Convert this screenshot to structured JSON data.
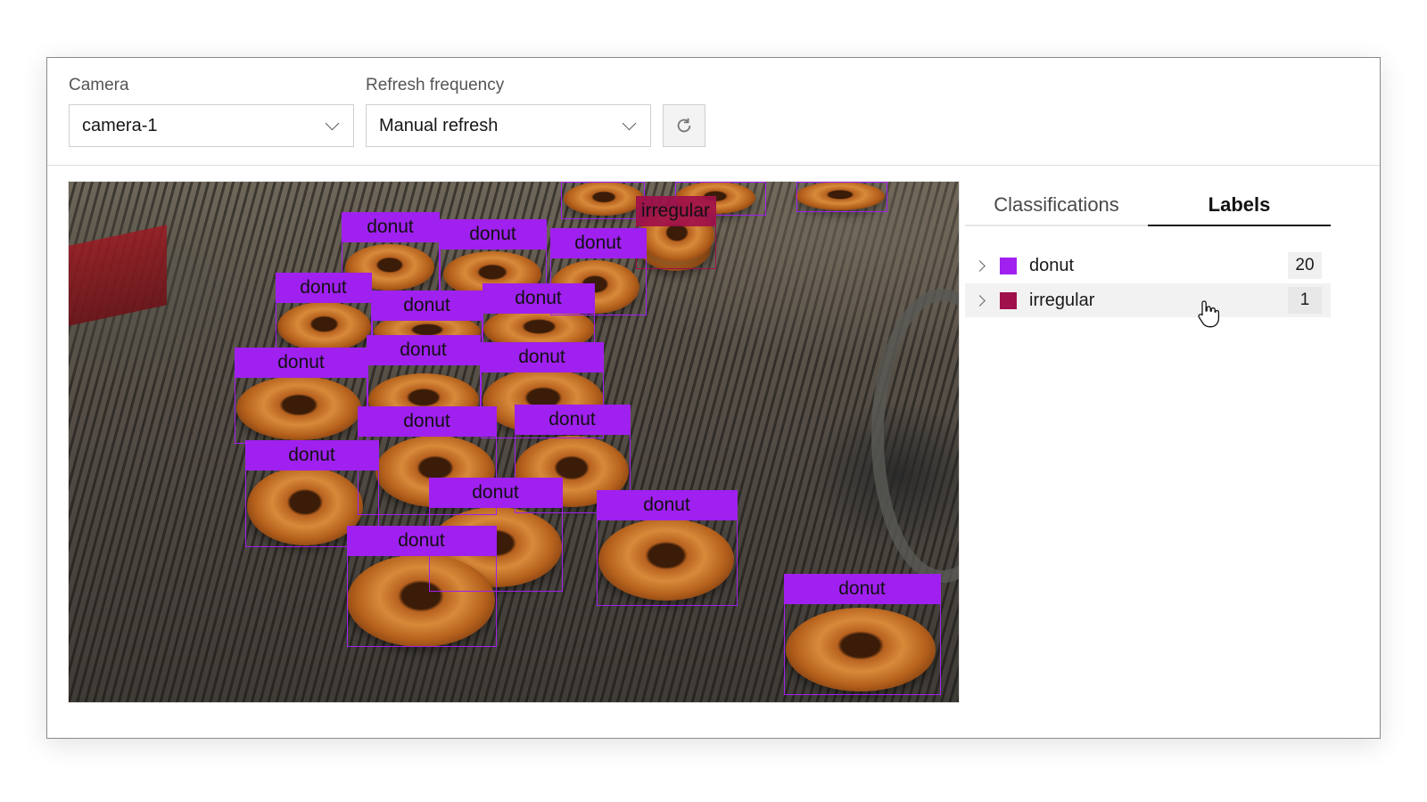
{
  "controls": {
    "camera": {
      "label": "Camera",
      "value": "camera-1"
    },
    "refresh": {
      "label": "Refresh frequency",
      "value": "Manual refresh"
    },
    "refresh_button_icon": "refresh-icon"
  },
  "tabs": [
    {
      "label": "Classifications",
      "active": false
    },
    {
      "label": "Labels",
      "active": true
    }
  ],
  "labels": [
    {
      "name": "donut",
      "count": "20",
      "color": "#a020f0"
    },
    {
      "name": "irregular",
      "count": "1",
      "color": "#a0104a"
    }
  ],
  "detections": {
    "tag_text_donut": "donut",
    "tag_text_irregular": "irregular"
  }
}
